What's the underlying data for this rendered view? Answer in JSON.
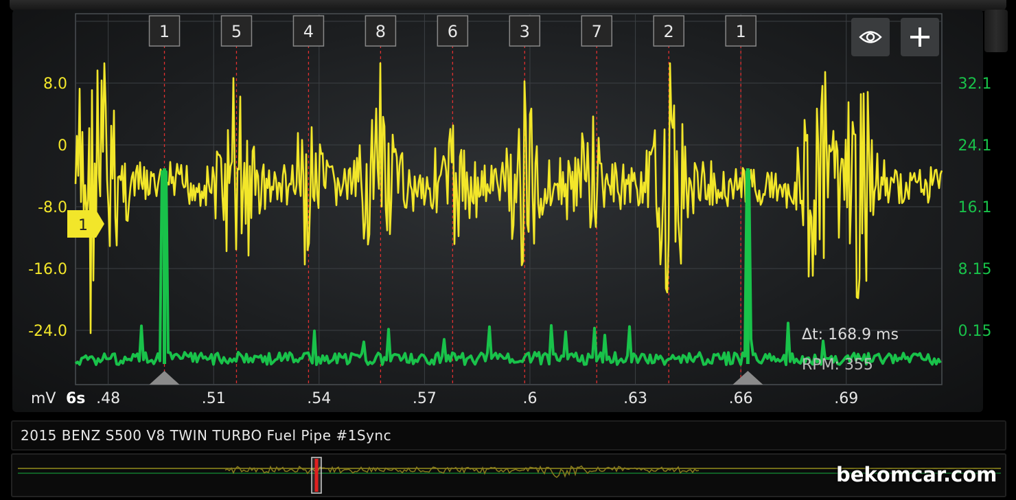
{
  "colors": {
    "channel1": "#f2e62a",
    "channel2": "#19c24a",
    "cylinder_marker": "#e03030",
    "grid": "#3c4044",
    "axis_text": "#e8e8e8"
  },
  "scope": {
    "cylinders": [
      "1",
      "5",
      "4",
      "8",
      "6",
      "3",
      "7",
      "2",
      "1"
    ],
    "cylinder_times": [
      0.496,
      0.5165,
      0.537,
      0.5575,
      0.578,
      0.5985,
      0.619,
      0.6395,
      0.66
    ],
    "left_axis": {
      "unit": "mV",
      "ticks": [
        "8.0",
        "0",
        "-8.0",
        "-16.0",
        "-24.0"
      ]
    },
    "right_axis": {
      "ticks": [
        "32.1",
        "24.1",
        "16.1",
        "8.15",
        "0.15"
      ]
    },
    "time_window": "6s",
    "time_ticks": [
      ".48",
      ".51",
      ".54",
      ".57",
      ".6",
      ".63",
      ".66",
      ".69"
    ],
    "time_values": [
      0.48,
      0.51,
      0.54,
      0.57,
      0.6,
      0.63,
      0.66,
      0.69
    ],
    "channel_marker": "1",
    "cursor_times": [
      0.496,
      0.662
    ],
    "measurement": {
      "delta_t": "Δt: 168.9 ms",
      "rpm": "RPM: 355"
    }
  },
  "toolbar": {
    "visibility_icon": "eye-icon",
    "add_icon": "plus-icon"
  },
  "capture_title": "2015 BENZ S500 V8 TWIN TURBO Fuel Pipe #1Sync",
  "watermark": "bekomcar.com"
}
